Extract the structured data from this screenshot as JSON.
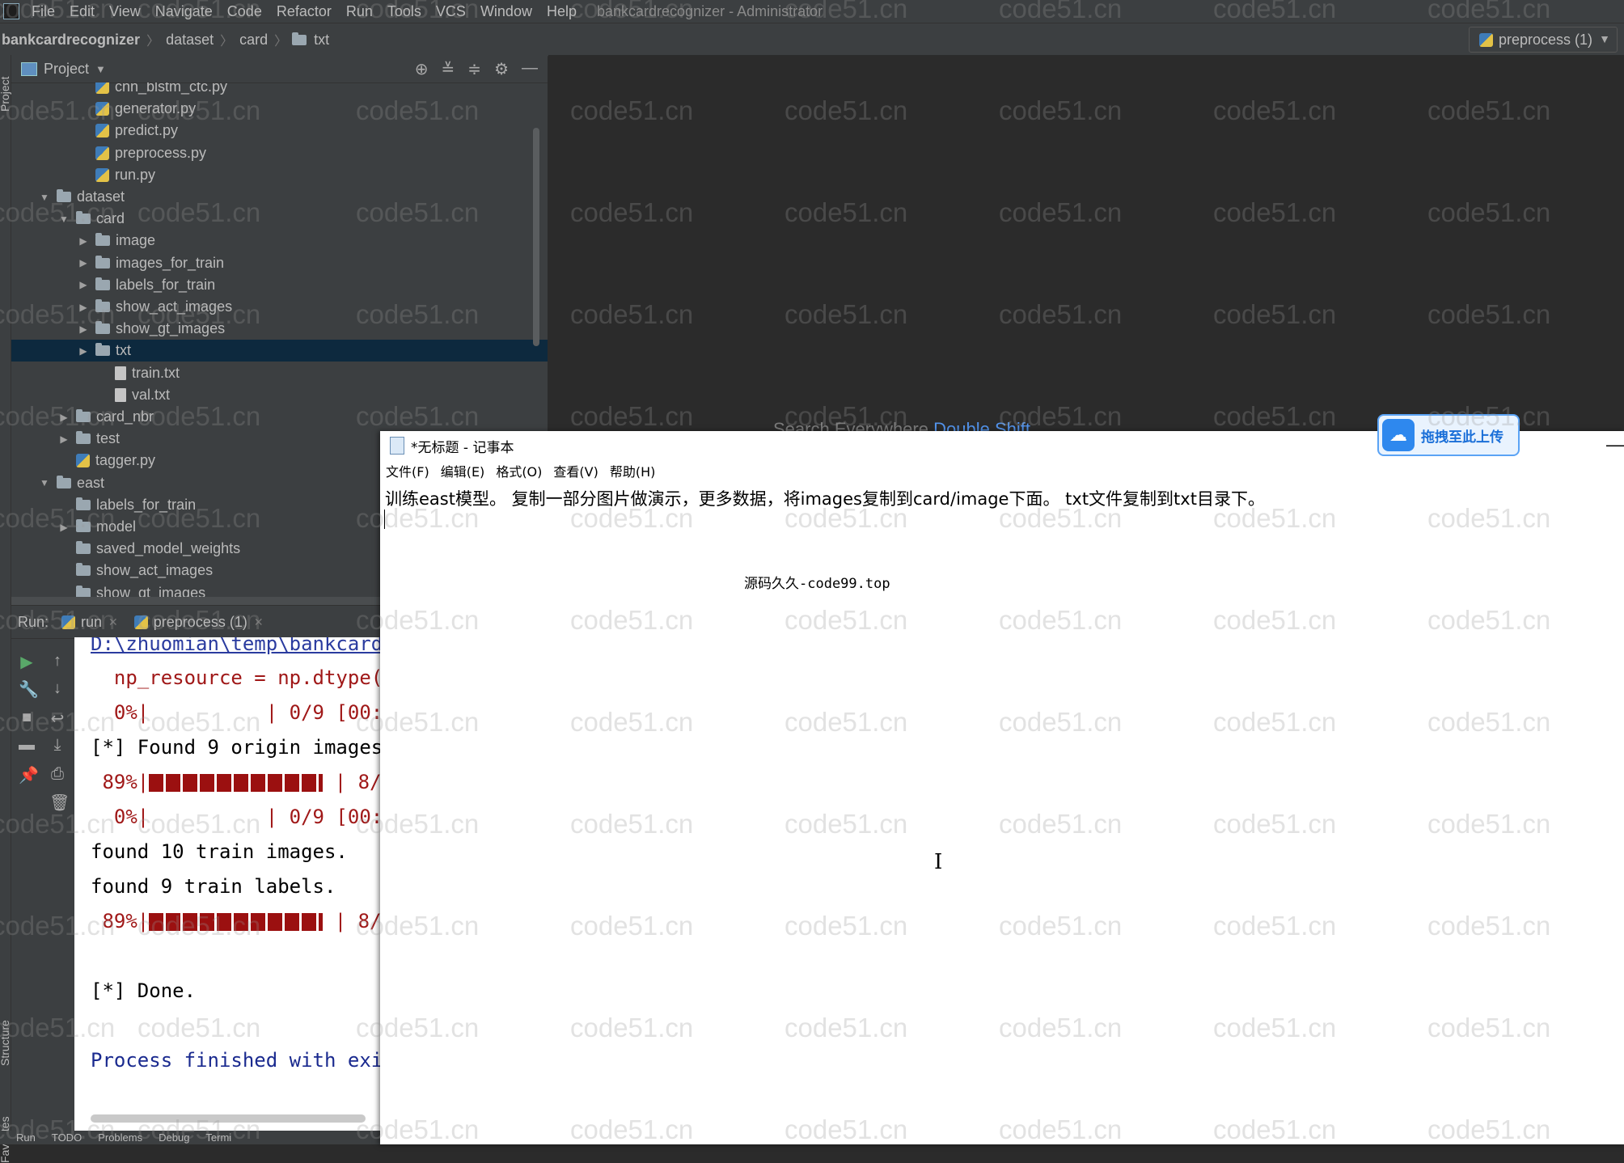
{
  "menubar": {
    "items": [
      "File",
      "Edit",
      "View",
      "Navigate",
      "Code",
      "Refactor",
      "Run",
      "Tools",
      "VCS",
      "Window",
      "Help"
    ],
    "window_title": "bankcardrecognizer - Administrator"
  },
  "navbar": {
    "crumbs": [
      "bankcardrecognizer",
      "dataset",
      "card",
      "txt"
    ],
    "run_config": "preprocess (1)"
  },
  "left_strip": {
    "top_tab": "Project",
    "structure_tab": "Structure",
    "favorites_tab": "Favorites"
  },
  "project_panel": {
    "title": "Project",
    "tree": [
      {
        "label": "cnn_blstm_ctc.py",
        "type": "py",
        "indent": 3,
        "arrow": "none"
      },
      {
        "label": "generator.py",
        "type": "py",
        "indent": 3,
        "arrow": "none"
      },
      {
        "label": "predict.py",
        "type": "py",
        "indent": 3,
        "arrow": "none"
      },
      {
        "label": "preprocess.py",
        "type": "py",
        "indent": 3,
        "arrow": "none"
      },
      {
        "label": "run.py",
        "type": "py",
        "indent": 3,
        "arrow": "none"
      },
      {
        "label": "dataset",
        "type": "folder",
        "indent": 1,
        "arrow": "open"
      },
      {
        "label": "card",
        "type": "folder",
        "indent": 2,
        "arrow": "open"
      },
      {
        "label": "image",
        "type": "folder",
        "indent": 3,
        "arrow": "closed"
      },
      {
        "label": "images_for_train",
        "type": "folder",
        "indent": 3,
        "arrow": "closed"
      },
      {
        "label": "labels_for_train",
        "type": "folder",
        "indent": 3,
        "arrow": "closed"
      },
      {
        "label": "show_act_images",
        "type": "folder",
        "indent": 3,
        "arrow": "closed"
      },
      {
        "label": "show_gt_images",
        "type": "folder",
        "indent": 3,
        "arrow": "closed"
      },
      {
        "label": "txt",
        "type": "folder",
        "indent": 3,
        "arrow": "closed",
        "selected": true
      },
      {
        "label": "train.txt",
        "type": "txt",
        "indent": 4,
        "arrow": "none"
      },
      {
        "label": "val.txt",
        "type": "txt",
        "indent": 4,
        "arrow": "none"
      },
      {
        "label": "card_nbr",
        "type": "folder",
        "indent": 2,
        "arrow": "closed"
      },
      {
        "label": "test",
        "type": "folder",
        "indent": 2,
        "arrow": "closed"
      },
      {
        "label": "tagger.py",
        "type": "py",
        "indent": 2,
        "arrow": "none"
      },
      {
        "label": "east",
        "type": "folder",
        "indent": 1,
        "arrow": "open"
      },
      {
        "label": "labels_for_train",
        "type": "folder",
        "indent": 2,
        "arrow": "none"
      },
      {
        "label": "model",
        "type": "folder",
        "indent": 2,
        "arrow": "closed"
      },
      {
        "label": "saved_model_weights",
        "type": "folder",
        "indent": 2,
        "arrow": "none"
      },
      {
        "label": "show_act_images",
        "type": "folder",
        "indent": 2,
        "arrow": "none"
      },
      {
        "label": "show_gt_images",
        "type": "folder",
        "indent": 2,
        "arrow": "none"
      },
      {
        "label": "...",
        "type": "py",
        "indent": 2,
        "arrow": "none"
      }
    ]
  },
  "run_panel": {
    "label": "Run:",
    "tabs": [
      "run",
      "preprocess (1)"
    ],
    "console": {
      "line1": "D:\\zhuomian\\temp\\bankcard",
      "line2": "  np_resource = np.dtype(",
      "line3": "  0%|          | 0/9 [00:",
      "line4": "[*] Found 9 origin images",
      "line5_pct": " 89%|",
      "line5_tail": " | 8/",
      "line6": "  0%|          | 0/9 [00:",
      "line7": "found 10 train images.",
      "line8": "found 9 train labels.",
      "line9_pct": " 89%|",
      "line9_tail": " | 8/",
      "line10": "[*] Done.",
      "line11": "Process finished with exi"
    },
    "progress": 0.89
  },
  "bottom_bar": {
    "items": [
      "Run",
      "TODO",
      "Problems",
      "Debug",
      "Termi"
    ]
  },
  "editor": {
    "search_hint": "Search Everywhere",
    "search_key": "Double Shift"
  },
  "notepad": {
    "title": "*无标题 - 记事本",
    "menu": [
      "文件(F)",
      "编辑(E)",
      "格式(O)",
      "查看(V)",
      "帮助(H)"
    ],
    "text": "训练east模型。 复制一部分图片做演示，更多数据，将images复制到card/image下面。 txt文件复制到txt目录下。",
    "footer": "源码久久-code99.top"
  },
  "upload_button": {
    "label": "拖拽至此上传"
  },
  "watermark": "code51.cn"
}
